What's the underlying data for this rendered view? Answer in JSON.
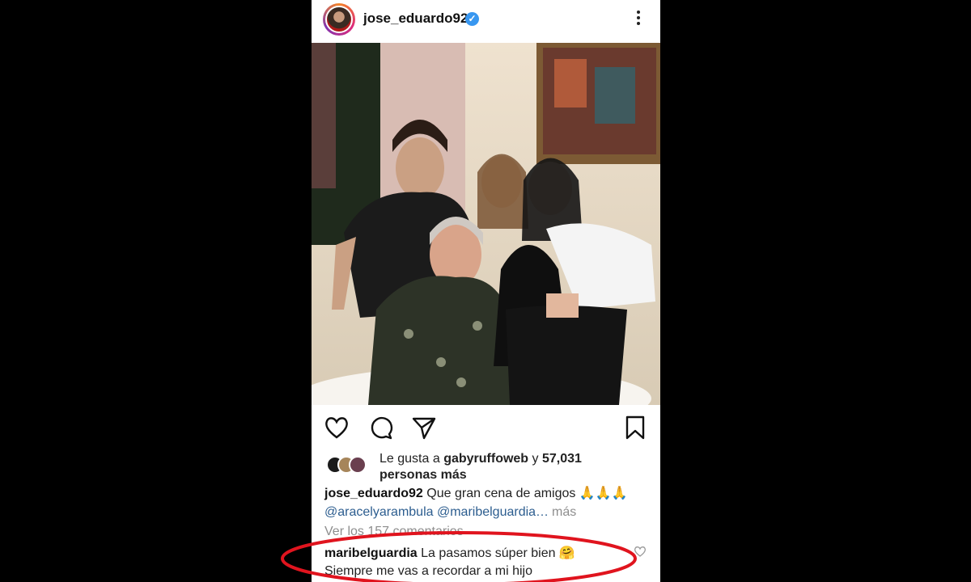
{
  "post": {
    "username": "jose_eduardo92",
    "verified_icon": "verified-badge-icon",
    "more_icon": "more-vertical-icon"
  },
  "photo": {
    "alt": "",
    "icon": "photo"
  },
  "actions": {
    "like_icon": "heart-icon",
    "comment_icon": "comment-icon",
    "share_icon": "send-icon",
    "save_icon": "bookmark-icon"
  },
  "likes": {
    "prefix": "Le gusta a",
    "user": "gabyruffoweb",
    "connector": "y",
    "count": "57,031",
    "suffix": "personas más"
  },
  "caption": {
    "username": "jose_eduardo92",
    "text": "Que gran cena de amigos 🙏🙏🙏",
    "mentions": "@aracelyarambula @maribelguardia…",
    "more_label": "más"
  },
  "comments": {
    "view_all": "Ver los 157 comentarios",
    "items": [
      {
        "username": "maribelguardia",
        "text_line1": "La pasamos súper bien 🤗",
        "text_line2": "Siempre me vas a recordar a mi hijo"
      }
    ]
  },
  "colors": {
    "annotation": "#e0141e",
    "link": "#2c5d8f",
    "muted": "#8e8e8e",
    "verified": "#3897f0"
  }
}
